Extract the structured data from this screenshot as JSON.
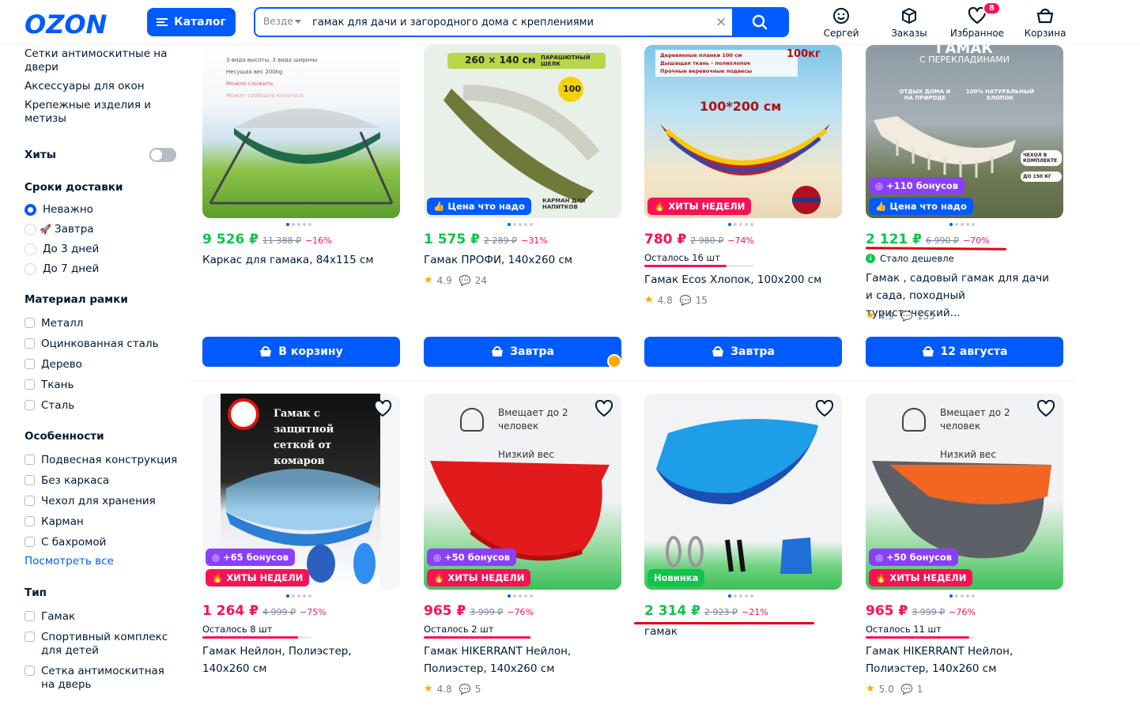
{
  "header": {
    "logo": "OZON",
    "catalog_label": "Каталог",
    "search_scope": "Везде",
    "search_value": "гамак для дачи и загородного дома с креплениями",
    "nav": [
      {
        "label": "Сергей",
        "icon": "user-face-icon"
      },
      {
        "label": "Заказы",
        "icon": "box-icon"
      },
      {
        "label": "Избранное",
        "icon": "heart-icon",
        "badge": "8"
      },
      {
        "label": "Корзина",
        "icon": "basket-icon"
      }
    ]
  },
  "sidebar": {
    "top_links": [
      "Сетки антимоскитные на двери",
      "Аксессуары для окон",
      "Крепежные изделия и метизы"
    ],
    "hits_label": "Хиты",
    "delivery": {
      "title": "Сроки доставки",
      "options": [
        "Неважно",
        "Завтра",
        "До 3 дней",
        "До 7 дней"
      ]
    },
    "frame": {
      "title": "Материал рамки",
      "options": [
        "Металл",
        "Оцинкованная сталь",
        "Дерево",
        "Ткань",
        "Сталь"
      ]
    },
    "features": {
      "title": "Особенности",
      "options": [
        "Подвесная конструкция",
        "Без каркаса",
        "Чехол для хранения",
        "Карман",
        "С бахромой"
      ],
      "more": "Посмотреть все"
    },
    "type": {
      "title": "Тип",
      "options": [
        "Гамак",
        "Спортивный комплекс для детей",
        "Сетка антимоскитная на дверь"
      ]
    }
  },
  "products": [
    {
      "price": "9 526 ₽",
      "old": "11 388 ₽",
      "disc": "−16%",
      "title": "Каркас для гамака, 84х115 см",
      "button": "В корзину",
      "img": {
        "lines": [
          "3 вида высоты, 3 вида ширины",
          "Несущая вес 200kg",
          "Можно сложить",
          "Может свободно качаться"
        ]
      }
    },
    {
      "price": "1 575 ₽",
      "old": "2 289 ₽",
      "disc": "−31%",
      "title": "Гамак ПРОФИ, 140х260 см",
      "rating": "4.9",
      "reviews": "24",
      "button": "Завтра",
      "tag": "Цена что надо",
      "img": {
        "size": "260 × 140 см",
        "badge": "ПАРАШЮТНЫЙ ШЕЛК",
        "pocket": "КАРМАН ДЛЯ НАПИТКОВ",
        "num": "100"
      }
    },
    {
      "price": "780 ₽",
      "old": "2 980 ₽",
      "disc": "−74%",
      "stock": "Осталось 16 шт",
      "stock_pct": 0.75,
      "title": "Гамак Ecos Хлопок, 100х200 см",
      "rating": "4.8",
      "reviews": "15",
      "button": "Завтра",
      "tag": "ХИТЫ НЕДЕЛИ",
      "img": {
        "lines": [
          "Деревянные планки 100 см",
          "Дышащая ткань - полихлопок",
          "Прочные веревочные подвесы"
        ],
        "kg": "100кг",
        "size": "100*200 см"
      }
    },
    {
      "price": "2 121 ₽",
      "old": "6 990 ₽",
      "disc": "−70%",
      "cheaper": "Стало дешевле",
      "title": "Гамак , садовый гамак для дачи и сада, походный туристический...",
      "rating": "4.9",
      "reviews": "135",
      "button": "12 августа",
      "tag1": "+110 бонусов",
      "tag2": "Цена что надо",
      "img": {
        "title": "ГАМАК",
        "sub": "С ПЕРЕКЛАДИНАМИ",
        "f1": "ОТДЫХ ДОМА И НА ПРИРОДЕ",
        "f2": "100% НАТУРАЛЬНЫЙ ХЛОПОК",
        "f3": "ЧЕХОЛ В КОМПЛЕКТЕ",
        "f4": "ДО 150 КГ"
      }
    },
    {
      "price": "1 264 ₽",
      "old": "4 999 ₽",
      "disc": "−75%",
      "stock": "Осталось 8 шт",
      "stock_pct": 0.88,
      "title": "Гамак Нейлон, Полиэстер, 140х260 см",
      "tag1": "+65 бонусов",
      "tag2": "ХИТЫ НЕДЕЛИ",
      "img": {
        "banner": "Гамак с защитной сеткой от комаров"
      }
    },
    {
      "price": "965 ₽",
      "old": "3 999 ₽",
      "disc": "−76%",
      "stock": "Осталось 2 шт",
      "stock_pct": 0.98,
      "title": "Гамак HIKERRANT Нейлон, Полиэстер, 140х260 см",
      "rating": "4.8",
      "reviews": "5",
      "tag1": "+50 бонусов",
      "tag2": "ХИТЫ НЕДЕЛИ",
      "img": {
        "l1": "Вмещает до 2 человек",
        "l2": "Низкий вес"
      }
    },
    {
      "price": "2 314 ₽",
      "old": "2 923 ₽",
      "disc": "−21%",
      "title": "гамак",
      "tag": "Новинка"
    },
    {
      "price": "965 ₽",
      "old": "3 999 ₽",
      "disc": "−76%",
      "stock": "Осталось 11 шт",
      "stock_pct": 0.95,
      "title": "Гамак HIKERRANT Нейлон, Полиэстер, 140х260 см",
      "rating": "5.0",
      "reviews": "1",
      "tag1": "+50 бонусов",
      "tag2": "ХИТЫ НЕДЕЛИ",
      "img": {
        "l1": "Вмещает до 2 человек",
        "l2": "Низкий вес"
      }
    }
  ],
  "colors": {
    "brand": "#005bff",
    "green_price": "#10c44c",
    "red_price": "#f91155",
    "annotation": "#e00012"
  }
}
